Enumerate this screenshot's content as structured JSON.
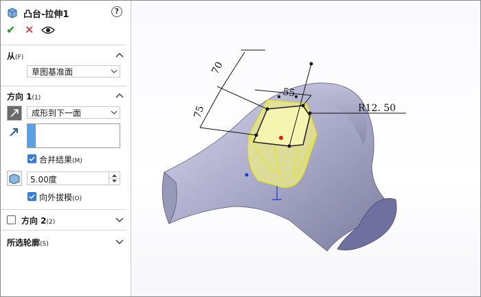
{
  "title": "凸台-拉伸1",
  "help_label": "?",
  "actions": {
    "ok": "✔",
    "cancel": "✕"
  },
  "from_section": {
    "title": "从",
    "suffix": "(F)",
    "dropdown_value": "草图基准面"
  },
  "direction1": {
    "title": "方向 1",
    "suffix": "(1)",
    "end_condition": "成形到下一面",
    "merge_label": "合并结果",
    "merge_suffix": "(M)",
    "draft_value": "5.00度",
    "draft_out_label": "向外拔模",
    "draft_out_suffix": "(O)"
  },
  "direction2": {
    "title": "方向 2",
    "suffix": "(2)"
  },
  "selected_contours": {
    "title": "所选轮廓",
    "suffix": "(S)"
  },
  "dimensions": {
    "d1": "70",
    "d2": "55",
    "d3": "75",
    "radius": "R12. 50"
  },
  "colors": {
    "accent_check": "#3a7bd5",
    "ok_green": "#1a9a1a",
    "cancel_red": "#d02020",
    "preview_yellow": "#f2f27a",
    "sketch_yellow": "#e8e800"
  }
}
